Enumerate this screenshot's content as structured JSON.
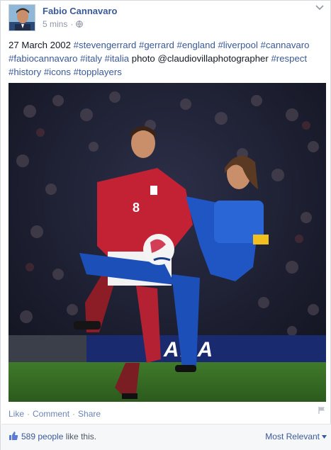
{
  "post": {
    "author": "Fabio Cannavaro",
    "time": "5 mins",
    "caption_prefix": "27 March 2002 ",
    "hashtags_1": "#stevengerrard #gerrard #england #liverpool #cannavaro #fabiocannavaro #italy #italia",
    "caption_mid": " photo ",
    "mention": "@claudiovillaphotographer",
    "caption_space": " ",
    "hashtags_2": "#respect #history #icons #topplayers",
    "photo": {
      "shirt_number": "8",
      "board_text": "AXA"
    }
  },
  "actions": {
    "like": "Like",
    "comment": "Comment",
    "share": "Share",
    "separator": "·"
  },
  "likes": {
    "count_text": "589 people",
    "suffix": " like this.",
    "sort_label": "Most Relevant"
  },
  "icons": {
    "privacy": "globe-icon",
    "options": "chevron-down-icon",
    "report": "flag-icon",
    "like": "thumbs-up-icon"
  },
  "colors": {
    "link": "#3b5998",
    "action_link": "#6d84b4",
    "muted": "#9197a3"
  }
}
